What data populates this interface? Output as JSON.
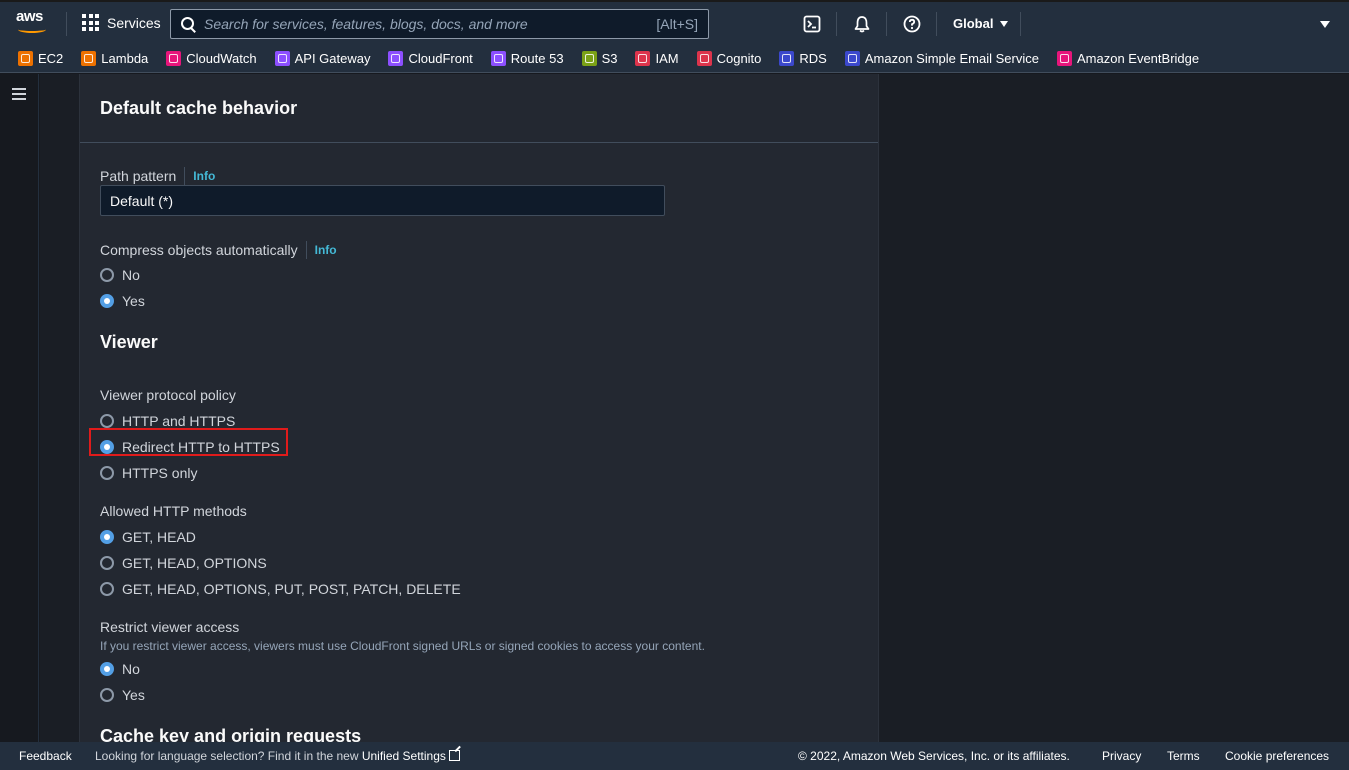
{
  "topnav": {
    "logo_text": "aws",
    "services_label": "Services",
    "search_placeholder": "Search for services, features, blogs, docs, and more",
    "search_shortcut": "[Alt+S]",
    "region_label": "Global"
  },
  "favorites": [
    {
      "label": "EC2",
      "color": "#ed7100"
    },
    {
      "label": "Lambda",
      "color": "#ed7100"
    },
    {
      "label": "CloudWatch",
      "color": "#e7157b"
    },
    {
      "label": "API Gateway",
      "color": "#8c4fff"
    },
    {
      "label": "CloudFront",
      "color": "#8c4fff"
    },
    {
      "label": "Route 53",
      "color": "#8c4fff"
    },
    {
      "label": "S3",
      "color": "#7aa116"
    },
    {
      "label": "IAM",
      "color": "#dd344c"
    },
    {
      "label": "Cognito",
      "color": "#dd344c"
    },
    {
      "label": "RDS",
      "color": "#3b48cc"
    },
    {
      "label": "Amazon Simple Email Service",
      "color": "#3b48cc"
    },
    {
      "label": "Amazon EventBridge",
      "color": "#e7157b"
    }
  ],
  "panel": {
    "title": "Default cache behavior",
    "path_pattern": {
      "label": "Path pattern",
      "info": "Info",
      "value": "Default (*)"
    },
    "compress": {
      "label": "Compress objects automatically",
      "info": "Info",
      "options": [
        "No",
        "Yes"
      ],
      "selected": "Yes"
    },
    "viewer_title": "Viewer",
    "viewer_protocol": {
      "label": "Viewer protocol policy",
      "options": [
        "HTTP and HTTPS",
        "Redirect HTTP to HTTPS",
        "HTTPS only"
      ],
      "selected": "Redirect HTTP to HTTPS"
    },
    "allowed_methods": {
      "label": "Allowed HTTP methods",
      "options": [
        "GET, HEAD",
        "GET, HEAD, OPTIONS",
        "GET, HEAD, OPTIONS, PUT, POST, PATCH, DELETE"
      ],
      "selected": "GET, HEAD"
    },
    "restrict": {
      "label": "Restrict viewer access",
      "hint": "If you restrict viewer access, viewers must use CloudFront signed URLs or signed cookies to access your content.",
      "options": [
        "No",
        "Yes"
      ],
      "selected": "No"
    },
    "next_section_title": "Cache key and origin requests"
  },
  "footer": {
    "feedback": "Feedback",
    "lang_msg": "Looking for language selection? Find it in the new ",
    "unified_settings": "Unified Settings",
    "copyright": "© 2022, Amazon Web Services, Inc. or its affiliates.",
    "privacy": "Privacy",
    "terms": "Terms",
    "cookie": "Cookie preferences"
  }
}
